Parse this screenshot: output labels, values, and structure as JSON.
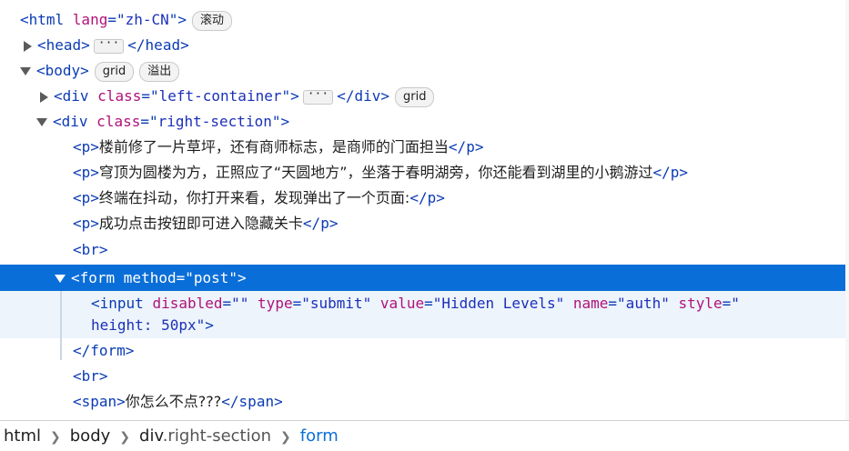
{
  "lines": {
    "html": {
      "tag_open": "<html ",
      "attr": "lang",
      "eq": "=\"",
      "val": "zh-CN",
      "close": "\">",
      "badge": "滚动"
    },
    "head": {
      "text_before": "<head>",
      "ellipsis": "···",
      "text_after": "</head>"
    },
    "body": {
      "text": "<body>",
      "badge1": "grid",
      "badge2": "溢出"
    },
    "left": {
      "tag_open": "<div ",
      "attr": "class",
      "eq": "=\"",
      "val": "left-container",
      "close": "\">",
      "ellipsis": "···",
      "end": "</div>",
      "badge": "grid"
    },
    "right": {
      "tag_open": "<div ",
      "attr": "class",
      "eq": "=\"",
      "val": "right-section",
      "close": "\">"
    },
    "p1": {
      "open": "<p>",
      "text": "楼前修了一片草坪，还有商师标志，是商师的门面担当",
      "close": "</p>"
    },
    "p2": {
      "open": "<p>",
      "text": "穹顶为圆楼为方，正照应了“天圆地方”，坐落于春明湖旁，你还能看到湖里的小鹅游过",
      "close": "</p>"
    },
    "p3": {
      "open": "<p>",
      "text": "终端在抖动，你打开来看，发现弹出了一个页面:",
      "close": "</p>"
    },
    "p4": {
      "open": "<p>",
      "text": "成功点击按钮即可进入隐藏关卡",
      "close": "</p>"
    },
    "br1": {
      "text": "<br>"
    },
    "form": {
      "tag_open": "<form ",
      "attr": "method",
      "eq": "=\"",
      "val": "post",
      "close": "\">"
    },
    "input": {
      "tag_open": "<input ",
      "a1": "disabled",
      "v1": "\"\"",
      "a2": "type",
      "v2": "\"submit\"",
      "a3": "value",
      "v3": "\"Hidden Levels\"",
      "a4": "name",
      "v4": "\"auth\"",
      "a5": "style",
      "v5a": "\"",
      "cont": "height: 50px",
      "v5b": "\"",
      "close": ">"
    },
    "form_end": {
      "text": "</form>"
    },
    "br2": {
      "text": "<br>"
    },
    "span": {
      "open": "<span>",
      "text": "你怎么不点???",
      "close": "</span>"
    }
  },
  "breadcrumb": {
    "html": "html",
    "body": "body",
    "div_tag": "div",
    "div_class": ".right-section",
    "form": "form"
  }
}
